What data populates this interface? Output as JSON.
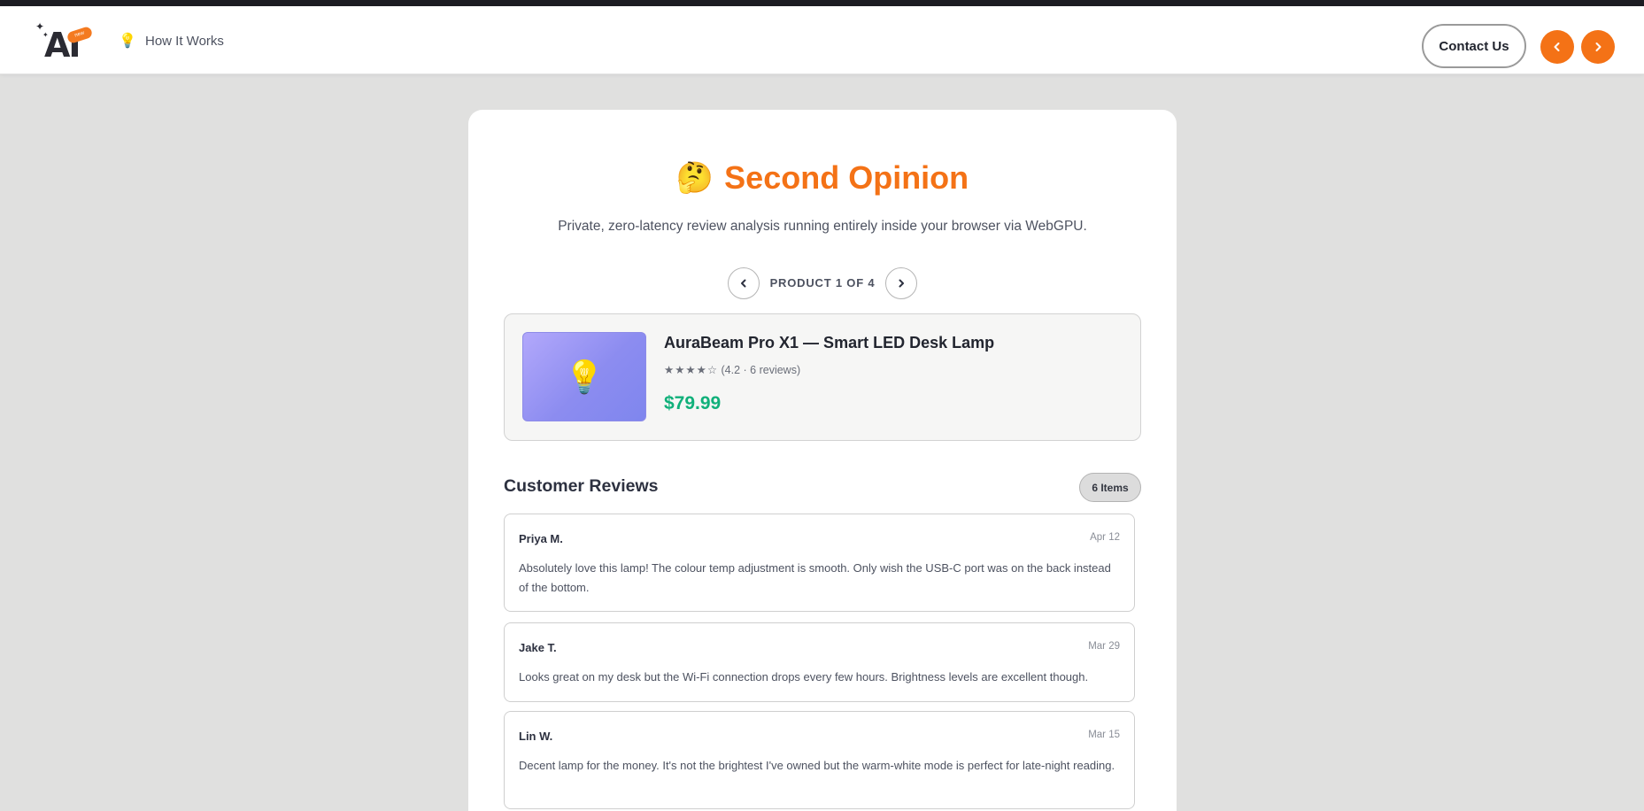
{
  "header": {
    "logo_text": "AI",
    "logo_badge": "new",
    "how_it_works": "How It Works",
    "contact_label": "Contact Us"
  },
  "app": {
    "title": "Second Opinion",
    "subtitle": "Private, zero-latency review analysis running entirely inside your browser via WebGPU."
  },
  "pager": {
    "label": "PRODUCT 1 OF 4"
  },
  "product": {
    "name": "AuraBeam Pro X1 — Smart LED Desk Lamp",
    "stars": "★★★★☆",
    "rating_text": "(4.2 · 6 reviews)",
    "rating": 4.2,
    "review_count": 6,
    "price": "$79.99",
    "image_gradient": [
      "#b2a8fb",
      "#7f86ee"
    ]
  },
  "reviews": {
    "title": "Customer Reviews",
    "badge": "6 Items",
    "items": [
      {
        "author": "Priya M.",
        "date": "Apr 12",
        "text": "Absolutely love this lamp! The colour temp adjustment is smooth. Only wish the USB-C port was on the back instead of the bottom."
      },
      {
        "author": "Jake T.",
        "date": "Mar 29",
        "text": "Looks great on my desk but the Wi-Fi connection drops every few hours. Brightness levels are excellent though."
      },
      {
        "author": "Lin W.",
        "date": "Mar 15",
        "text": "Decent lamp for the money. It's not the brightest I've owned but the warm-white mode is perfect for late-night reading."
      }
    ]
  },
  "colors": {
    "accent": "#f47216",
    "price": "#10b07a",
    "background": "#e0e0df",
    "text": "#2d3140"
  },
  "icons": {
    "title_emoji": "thinking-face-icon",
    "how_it_works": "light-bulb-icon",
    "product_image": "light-bulb-icon",
    "nav_prev": "chevron-left-icon",
    "nav_next": "chevron-right-icon"
  }
}
